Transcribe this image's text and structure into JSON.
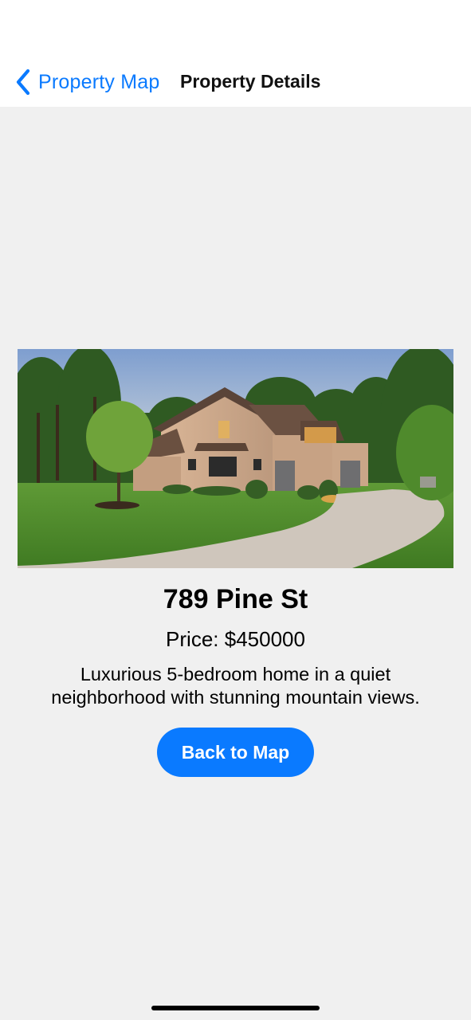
{
  "nav": {
    "back_label": "Property Map",
    "title": "Property Details",
    "back_icon": "chevron-left-icon"
  },
  "property": {
    "image_alt": "house-photo",
    "address": "789 Pine St",
    "price": "Price: $450000",
    "description": "Luxurious 5-bedroom home in a quiet neighborhood with stunning mountain views."
  },
  "actions": {
    "back_to_map_label": "Back to Map"
  },
  "colors": {
    "accent": "#0a7aff",
    "background": "#f0f0f0",
    "nav_background": "#ffffff"
  }
}
